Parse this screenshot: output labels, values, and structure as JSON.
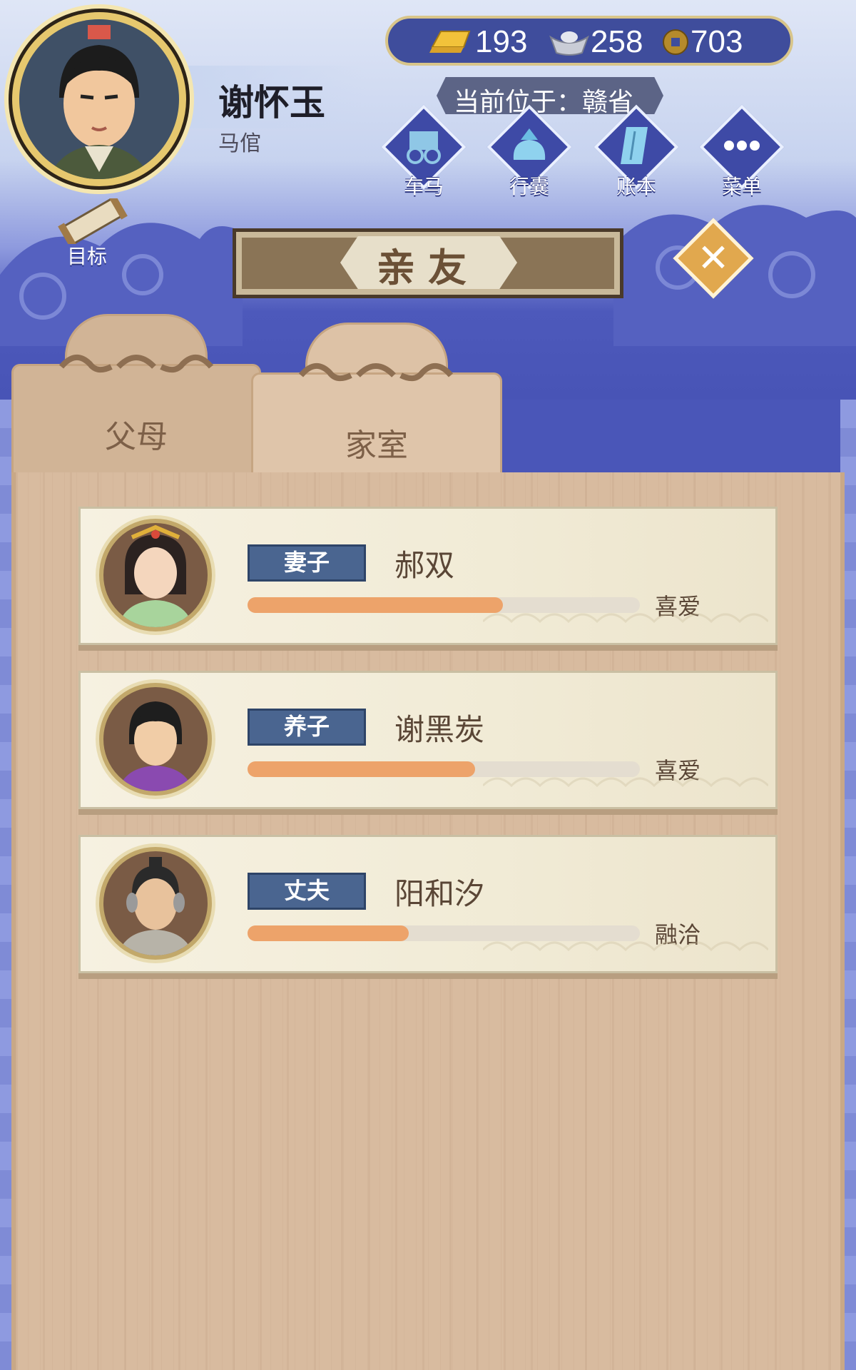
{
  "player": {
    "name": "谢怀玉",
    "title": "马倌",
    "location": "当前位于：赣省"
  },
  "currency": {
    "gold": "193",
    "silver": "258",
    "coins": "703"
  },
  "toolbar": [
    {
      "label": "车马",
      "icon": "carriage-icon"
    },
    {
      "label": "行囊",
      "icon": "bundle-icon"
    },
    {
      "label": "账本",
      "icon": "ledger-icon"
    },
    {
      "label": "菜单",
      "icon": "menu-dots-icon"
    }
  ],
  "goal_label": "目标",
  "panel": {
    "title": "亲友",
    "close_icon": "close-icon"
  },
  "tabs": [
    {
      "label": "父母",
      "active": false
    },
    {
      "label": "家室",
      "active": true
    }
  ],
  "members": [
    {
      "role": "妻子",
      "name": "郝双",
      "relation": "喜爱",
      "affection": 0.65
    },
    {
      "role": "养子",
      "name": "谢黑炭",
      "relation": "喜爱",
      "affection": 0.58
    },
    {
      "role": "丈夫",
      "name": "阳和汐",
      "relation": "融洽",
      "affection": 0.41
    }
  ],
  "colors": {
    "accent_blue": "#4a56b8",
    "bar_fill": "#eda36a",
    "tag_blue": "#4a6590",
    "wood": "#d8bb9f"
  }
}
